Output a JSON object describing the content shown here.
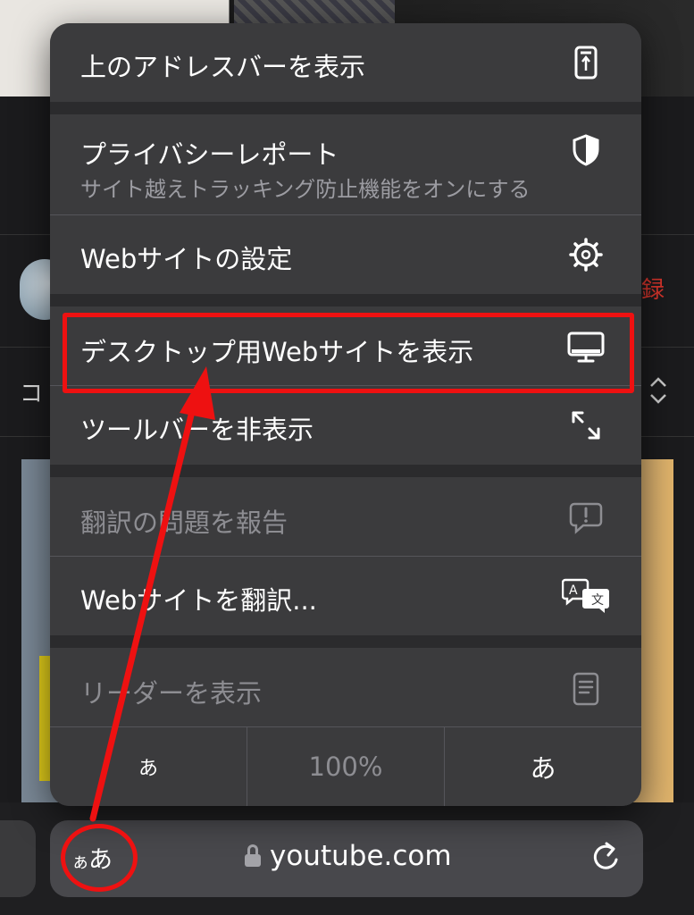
{
  "background": {
    "subscribe_fragment": "録",
    "comment_fragment": "コ"
  },
  "menu": {
    "items": [
      {
        "label": "上のアドレスバーを表示",
        "icon": "address-bar-top-icon"
      },
      {
        "label": "プライバシーレポート",
        "sublabel": "サイト越えトラッキング防止機能をオンにする",
        "icon": "shield-icon"
      },
      {
        "label": "Webサイトの設定",
        "icon": "gear-icon"
      },
      {
        "label": "デスクトップ用Webサイトを表示",
        "icon": "desktop-icon"
      },
      {
        "label": "ツールバーを非表示",
        "icon": "expand-arrows-icon"
      },
      {
        "label": "翻訳の問題を報告",
        "icon": "report-bubble-icon",
        "disabled": true
      },
      {
        "label": "Webサイトを翻訳...",
        "icon": "translate-icon"
      },
      {
        "label": "リーダーを表示",
        "icon": "reader-icon",
        "disabled": true
      }
    ],
    "font_controls": {
      "smaller": "あ",
      "zoom": "100%",
      "larger": "あ"
    }
  },
  "address_bar": {
    "aa_label_small": "ぁ",
    "aa_label_large": "あ",
    "url": "youtube.com"
  },
  "colors": {
    "annotation": "#ee1111",
    "menu_bg": "#3b3b3d",
    "subscribe_red": "#d9352c"
  }
}
